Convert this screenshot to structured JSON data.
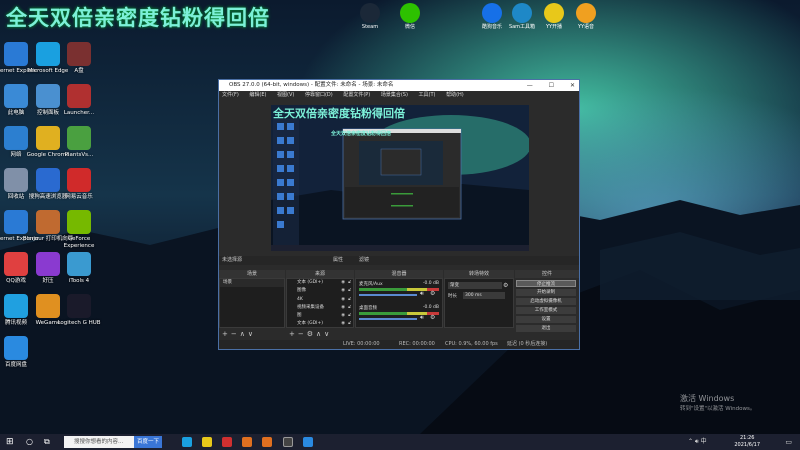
{
  "overlay_text": "全天双倍亲密度钻粉得回倍",
  "top_icons": [
    {
      "label": "Steam",
      "color": "#1b2838"
    },
    {
      "label": "微信",
      "color": "#2dc100"
    },
    {
      "label": "酷狗音乐",
      "color": "#1670e8"
    },
    {
      "label": "Sam工具箱",
      "color": "#1e88c7"
    },
    {
      "label": "YY开播",
      "color": "#e8c81a"
    },
    {
      "label": "YY语音",
      "color": "#f0a020"
    }
  ],
  "desktop_icons": [
    {
      "label": "Internet Explorer",
      "color": "#2a7ad5"
    },
    {
      "label": "Microsoft Edge",
      "color": "#1aa0e0"
    },
    {
      "label": "A盘",
      "color": "#7a3030"
    },
    {
      "label": "此电脑",
      "color": "#3a8ad6"
    },
    {
      "label": "控制面板",
      "color": "#4a90d0"
    },
    {
      "label": "Launcher...",
      "color": "#b03030"
    },
    {
      "label": "网络",
      "color": "#2c7fd0"
    },
    {
      "label": "Google Chrome",
      "color": "#e0b020"
    },
    {
      "label": "PlantsVs...",
      "color": "#4aa040"
    },
    {
      "label": "回收站",
      "color": "#8090a8"
    },
    {
      "label": "搜狗高速浏览器",
      "color": "#2a6ad0"
    },
    {
      "label": "网易云音乐",
      "color": "#d02a2a"
    },
    {
      "label": "Internet Explorer",
      "color": "#2a7ad5"
    },
    {
      "label": "Bonjour 打印机向导",
      "color": "#c06a30"
    },
    {
      "label": "GeForce Experience",
      "color": "#76b900"
    },
    {
      "label": "QQ游戏",
      "color": "#e04040"
    },
    {
      "label": "好压",
      "color": "#8a3ad0"
    },
    {
      "label": "iTools 4",
      "color": "#3a9ad0"
    },
    {
      "label": "腾讯视频",
      "color": "#20a0e0"
    },
    {
      "label": "WeGame",
      "color": "#e09020"
    },
    {
      "label": "Logitech G HUB",
      "color": "#1a1a2a"
    },
    {
      "label": "百度网盘",
      "color": "#2a8ae0"
    }
  ],
  "obs": {
    "title": "OBS 27.0.0 (64-bit, windows) - 配置文件: 未命名 - 场景: 未命名",
    "menu": [
      "文件(F)",
      "编辑(E)",
      "视图(V)",
      "停靠窗口(D)",
      "配置文件(P)",
      "场景集合(S)",
      "工具(T)",
      "帮助(H)"
    ],
    "no_source": "未选择源",
    "props_label": "属性",
    "filter_label": "滤镜",
    "docks": [
      "场景",
      "来源",
      "混音器",
      "转场特效",
      "控件"
    ],
    "scene_name": "场景",
    "sources": [
      "文本 (GDI+)",
      "图像",
      "4K",
      "视频采集设备",
      "图",
      "文本 (GDI+)"
    ],
    "mixer": [
      {
        "name": "麦克风/Aux",
        "db": "-0.0 dB"
      },
      {
        "name": "桌面音频",
        "db": "-0.0 dB"
      }
    ],
    "transition": {
      "type": "渐变",
      "duration_label": "时长",
      "duration": "300 ms"
    },
    "controls": [
      "停止推流",
      "开始录制",
      "启动虚拟摄像机",
      "工作室模式",
      "设置",
      "退出"
    ],
    "status": {
      "live": "LIVE: 00:00:00",
      "rec": "REC: 00:00:00",
      "cpu": "CPU: 0.9%, 60.00 fps",
      "net": "延迟 (0 秒后连接)"
    }
  },
  "watermark": {
    "line1": "激活 Windows",
    "line2": "转到\"设置\"以激活 Windows。"
  },
  "taskbar": {
    "search_placeholder": "搜搜你想看的内容...",
    "search_button": "百度一下",
    "time": "21:26",
    "date": "2021/6/17"
  }
}
